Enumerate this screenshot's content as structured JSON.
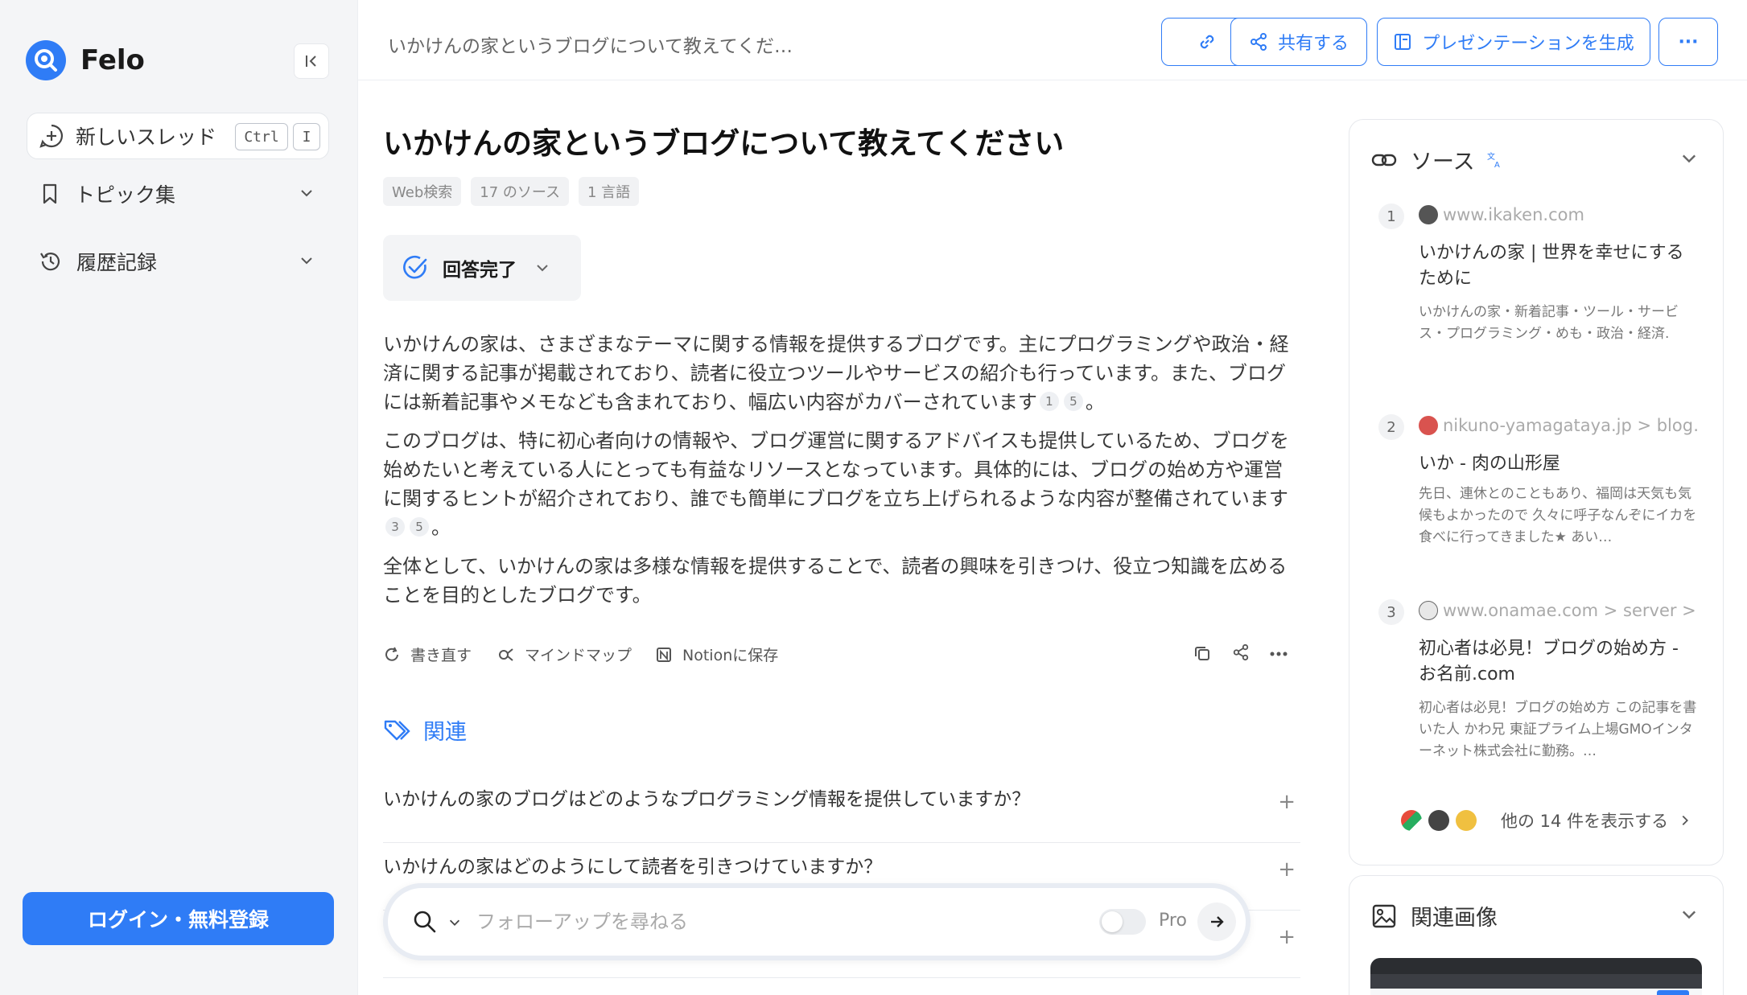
{
  "sidebar": {
    "brand": "Felo",
    "new_thread": "新しいスレッド",
    "shortcut_ctrl": "Ctrl",
    "shortcut_key": "I",
    "nav": [
      {
        "label": "トピック集"
      },
      {
        "label": "履歴記録"
      }
    ],
    "login": "ログイン・無料登録"
  },
  "header": {
    "breadcrumb": "いかけんの家というブログについて教えてくだ…",
    "share": "共有する",
    "presentation": "プレゼンテーションを生成",
    "more": "···"
  },
  "question": {
    "title": "いかけんの家というブログについて教えてください",
    "tags": [
      "Web検索",
      "17 のソース",
      "1 言語"
    ],
    "status": "回答完了"
  },
  "answer": {
    "p1": "いかけんの家は、さまざまなテーマに関する情報を提供するブログです。主にプログラミングや政治・経済に関する記事が掲載されており、読者に役立つツールやサービスの紹介も行っています。また、ブログには新着記事やメモなども含まれており、幅広い内容がカバーされています",
    "p1_cites": [
      "1",
      "5"
    ],
    "p2": "このブログは、特に初心者向けの情報や、ブログ運営に関するアドバイスも提供しているため、ブログを始めたいと考えている人にとっても有益なリソースとなっています。具体的には、ブログの始め方や運営に関するヒントが紹介されており、誰でも簡単にブログを立ち上げられるような内容が整備されています",
    "p2_cites": [
      "3",
      "5"
    ],
    "p3": "全体として、いかけんの家は多様な情報を提供することで、読者の興味を引きつけ、役立つ知識を広めることを目的としたブログです。",
    "period": "。"
  },
  "actions": {
    "rewrite": "書き直す",
    "mindmap": "マインドマップ",
    "notion": "Notionに保存"
  },
  "related": {
    "heading": "関連",
    "items": [
      "いかけんの家のブログはどのようなプログラミング情報を提供していますか？",
      "いかけんの家はどのようにして読者を引きつけていますか？"
    ]
  },
  "followup": {
    "placeholder": "フォローアップを尋ねる",
    "pro_label": "Pro",
    "pro_enabled": false
  },
  "sources": {
    "heading": "ソース",
    "items": [
      {
        "num": "1",
        "domain": "www.ikaken.com",
        "title": "いかけんの家 | 世界を幸せにするために",
        "snippet": "いかけんの家・新着記事・ツール・サービス・プログラミング・めも・政治・経済."
      },
      {
        "num": "2",
        "domain": "nikuno-yamagataya.jp > blog…",
        "title": "いか - 肉の山形屋",
        "snippet": "先日、連休とのこともあり、福岡は天気も気候もよかったので 久々に呼子なんぞにイカを食べに行ってきました★ あい…"
      },
      {
        "num": "3",
        "domain": "www.onamae.com > server > …",
        "title": "初心者は必見！ブログの始め方 - お名前.com",
        "snippet": "初心者は必見！ブログの始め方 この記事を書いた人 かわ兄 東証プライム上場GMOインターネット株式会社に勤務。…"
      }
    ],
    "show_more": "他の 14 件を表示する"
  },
  "images": {
    "heading": "関連画像"
  },
  "colors": {
    "accent": "#2f7cf6",
    "sidebar_bg": "#f4f5f7"
  }
}
